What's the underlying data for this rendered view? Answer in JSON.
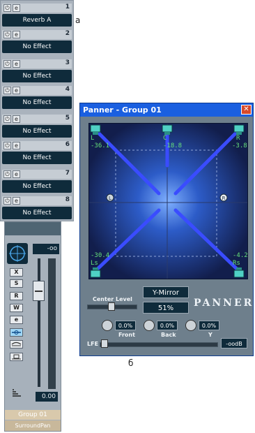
{
  "inserts": [
    {
      "number": "1",
      "name": "Reverb A"
    },
    {
      "number": "2",
      "name": "No Effect"
    },
    {
      "number": "3",
      "name": "No Effect"
    },
    {
      "number": "4",
      "name": "No Effect"
    },
    {
      "number": "5",
      "name": "No Effect"
    },
    {
      "number": "6",
      "name": "No Effect"
    },
    {
      "number": "7",
      "name": "No Effect"
    },
    {
      "number": "8",
      "name": "No Effect"
    }
  ],
  "insert_buttons": {
    "power_icon": "power-icon",
    "edit_label": "e"
  },
  "strip": {
    "level_display": "-oo",
    "buttons": [
      "X",
      "S",
      "R",
      "W",
      "e"
    ],
    "gain_display": "0.00",
    "group_name": "Group 01",
    "panner_name": "SurroundPan",
    "fader_level_fraction": 0.17
  },
  "panner": {
    "title": "Panner - Group 01",
    "close_label": "✕",
    "speakers": {
      "L": {
        "name": "L",
        "value": "-36.1"
      },
      "C": {
        "name": "C",
        "value": "-18.8"
      },
      "R": {
        "name": "R",
        "value": "-3.8"
      },
      "Ls": {
        "name": "Ls",
        "value": "-30.4"
      },
      "Rs": {
        "name": "Rs",
        "value": "-4.2"
      }
    },
    "center_level_label": "Center Level",
    "mode": "Y-Mirror",
    "center_percent": "51%",
    "logo_text": "PANNER",
    "front": {
      "label": "Front",
      "value": "0.0%"
    },
    "back": {
      "label": "Back",
      "value": "0.0%"
    },
    "y": {
      "label": "Y",
      "value": "0.0%"
    },
    "lfe_label": "LFE",
    "lfe_value": "-oodB"
  },
  "captions": {
    "a": "a",
    "b": "б"
  },
  "colors": {
    "accent": "#1a5fe0",
    "display_bg": "#0f2b3b",
    "pan_bg": "#152558",
    "pan_line": "#3a4cff",
    "readout": "#66e07a"
  }
}
